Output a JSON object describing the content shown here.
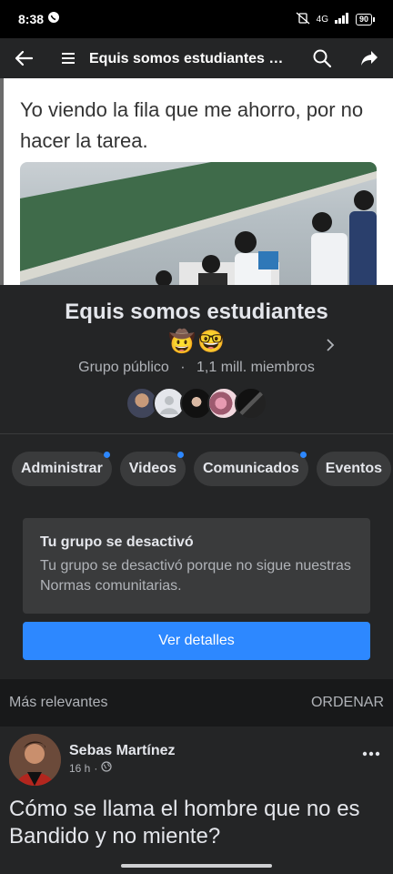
{
  "status_bar": {
    "time": "8:38",
    "network": "4G",
    "battery": "90"
  },
  "top_bar": {
    "title": "Equis somos estudiantes 🤠…",
    "icons": [
      "back-arrow-icon",
      "hamburger-menu-icon",
      "search-icon",
      "share-icon"
    ]
  },
  "cover": {
    "caption": "Yo viendo la fila que me ahorro, por no hacer la tarea."
  },
  "group": {
    "name": "Equis somos estudiantes",
    "emojis": [
      "🤠",
      "🤓"
    ],
    "privacy": "Grupo público",
    "separator": "·",
    "members": "1,1 mill. miembros"
  },
  "tabs": [
    {
      "label": "Administrar",
      "has_dot": true
    },
    {
      "label": "Videos",
      "has_dot": true
    },
    {
      "label": "Comunicados",
      "has_dot": true
    },
    {
      "label": "Eventos",
      "has_dot": false
    }
  ],
  "notice": {
    "title": "Tu grupo se desactivó",
    "body": "Tu grupo se desactivó porque no sigue nuestras Normas comunitarias.",
    "button": "Ver detalles"
  },
  "sort": {
    "label": "Más relevantes",
    "button": "ORDENAR"
  },
  "post": {
    "author": "Sebas Martínez",
    "time": "16 h",
    "separator": "·",
    "text": "Cómo se llama el hombre  que no es Bandido y no miente?"
  },
  "colors": {
    "accent": "#2d88ff",
    "surface": "#242526",
    "background": "#18191a"
  }
}
